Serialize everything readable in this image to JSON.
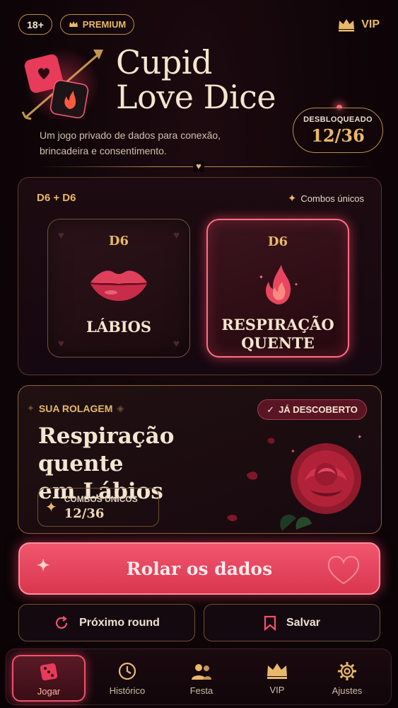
{
  "header": {
    "age_badge": "18+",
    "premium_label": "PREMIUM",
    "vip_label": "VIP"
  },
  "hero": {
    "title_line1": "Cupid",
    "title_line2": "Love Dice",
    "subtitle_line1": "Um jogo privado de dados para conexão,",
    "subtitle_line2": "brincadeira e consentimento.",
    "unlocked_label": "DESBLOQUEADO",
    "unlocked_value": "12/36"
  },
  "dice_panel": {
    "combo_label": "D6 + D6",
    "unique_combos_label": "Combos únicos",
    "dice": [
      {
        "type": "D6",
        "name": "LÁBIOS",
        "icon": "lips-icon"
      },
      {
        "type": "D6",
        "name_line1": "RESPIRAÇÃO",
        "name_line2": "QUENTE",
        "icon": "flame-icon"
      }
    ]
  },
  "roll": {
    "label": "SUA ROLAGEM",
    "discovered_badge": "JÁ DESCOBERTO",
    "result_line1": "Respiração quente",
    "result_line2": "em Lábios",
    "combos_label": "COMBOS ÚNICOS",
    "combos_value": "12/36"
  },
  "actions": {
    "roll_button": "Rolar os dados",
    "next_round": "Próximo round",
    "save": "Salvar"
  },
  "nav": {
    "items": [
      {
        "label": "Jogar",
        "icon": "dice-icon",
        "active": true
      },
      {
        "label": "Histórico",
        "icon": "clock-icon",
        "active": false
      },
      {
        "label": "Festa",
        "icon": "people-icon",
        "active": false
      },
      {
        "label": "VIP",
        "icon": "crown-icon",
        "active": false
      },
      {
        "label": "Ajustes",
        "icon": "gear-icon",
        "active": false
      }
    ]
  },
  "colors": {
    "accent_gold": "#e8b96a",
    "accent_pink": "#f2566f",
    "background": "#0f0508"
  }
}
